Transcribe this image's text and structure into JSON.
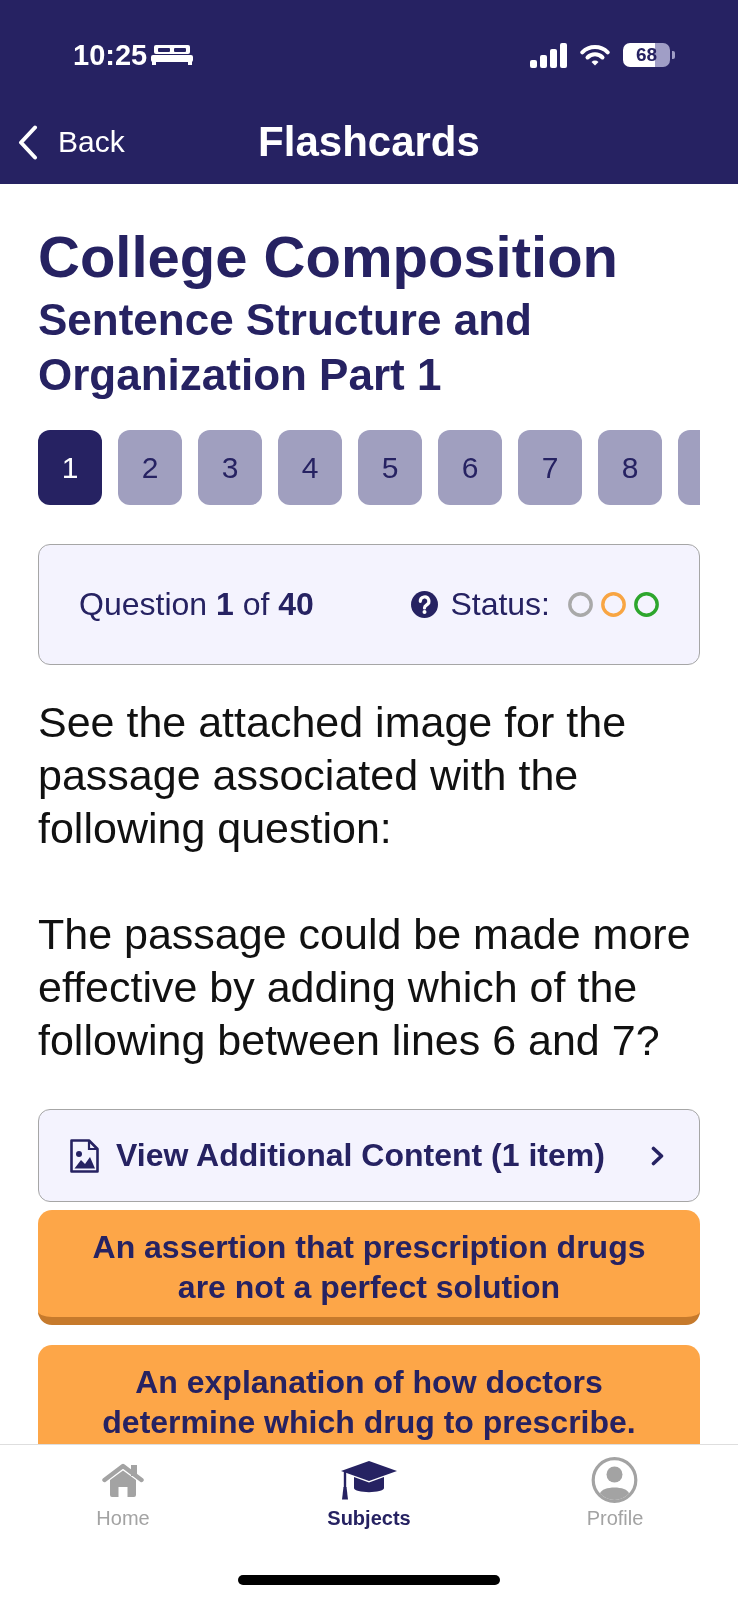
{
  "status_bar": {
    "time": "10:25",
    "battery": "68"
  },
  "nav": {
    "back": "Back",
    "title": "Flashcards"
  },
  "heading": {
    "title": "College Composition",
    "subtitle": "Sentence Structure and Organization Part 1"
  },
  "question_numbers": {
    "items": [
      {
        "label": "1",
        "selected": true
      },
      {
        "label": "2",
        "selected": false
      },
      {
        "label": "3",
        "selected": false
      },
      {
        "label": "4",
        "selected": false
      },
      {
        "label": "5",
        "selected": false
      },
      {
        "label": "6",
        "selected": false
      },
      {
        "label": "7",
        "selected": false
      },
      {
        "label": "8",
        "selected": false
      }
    ],
    "next_tile_clipped": true
  },
  "question_info": {
    "counter": "Question **1** of **40**",
    "status_label": "Status:",
    "status_rings": [
      {
        "color": "#a9a9a9"
      },
      {
        "color": "#f8a543"
      },
      {
        "color": "#2da62d"
      }
    ]
  },
  "question": {
    "paragraphs": [
      "See the attached image for the passage associated with the following question:",
      "The passage could be made more effective by adding which of the following between lines 6 and 7?"
    ]
  },
  "additional_content": {
    "label": "View Additional Content (1 item)"
  },
  "answers": [
    {
      "text": "An assertion that prescription drugs are not a perfect solution"
    },
    {
      "text": "An explanation of how doctors determine which drug to prescribe."
    }
  ],
  "tab_bar": {
    "tabs": [
      {
        "label": "Home",
        "kind": "home",
        "selected": false
      },
      {
        "label": "Subjects",
        "kind": "cap",
        "selected": true
      },
      {
        "label": "Profile",
        "kind": "person",
        "selected": false
      }
    ]
  }
}
